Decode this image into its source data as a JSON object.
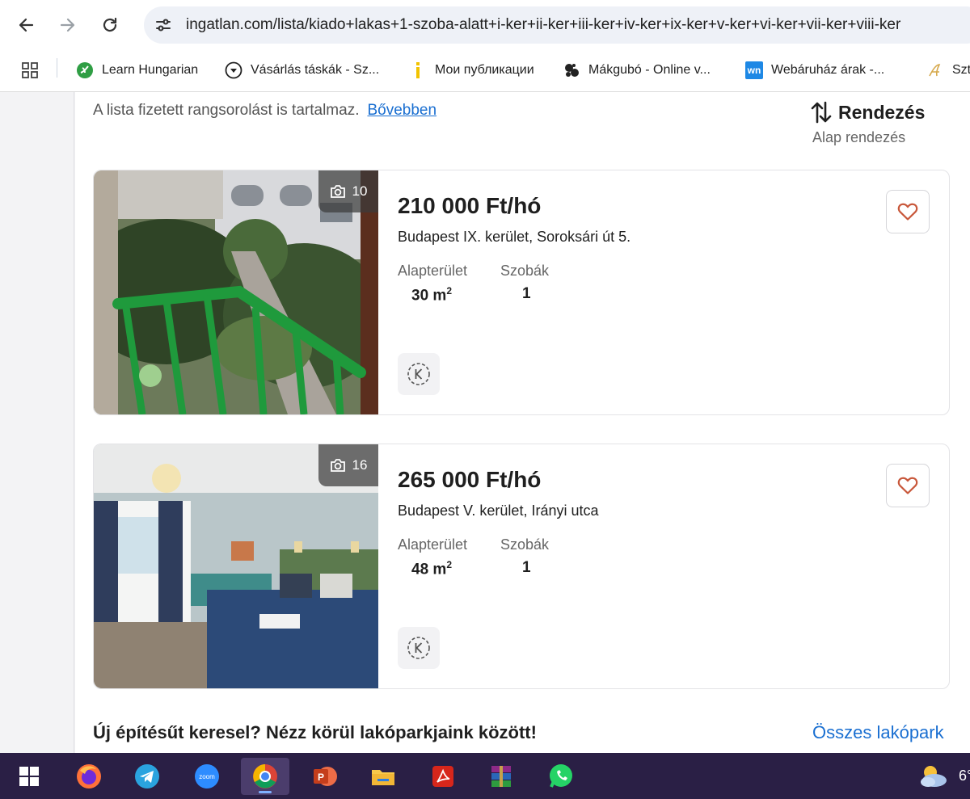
{
  "browser": {
    "url": "ingatlan.com/lista/kiado+lakas+1-szoba-alatt+i-ker+ii-ker+iii-ker+iv-ker+ix-ker+v-ker+vi-ker+vii-ker+viii-ker",
    "bookmarks": [
      {
        "label": "Learn Hungarian",
        "icon": "leaf-icon"
      },
      {
        "label": "Vásárlás táskák - Sz...",
        "icon": "chevron-circle-icon"
      },
      {
        "label": "Мои публикации",
        "icon": "yellow-bar-icon"
      },
      {
        "label": "Mákgubó - Online v...",
        "icon": "poppy-icon"
      },
      {
        "label": "Webáruház árak -...",
        "icon": "wn-icon",
        "icon_text": "wn"
      },
      {
        "label": "Szt",
        "icon": "script-a-icon"
      }
    ]
  },
  "listing_page": {
    "notice_text": "A lista fizetett rangsorolást is tartalmaz.",
    "notice_link": "Bővebben",
    "sort_label": "Rendezés",
    "sort_value": "Alap rendezés",
    "area_label": "Alapterület",
    "rooms_label": "Szobák",
    "area_unit": "m",
    "area_unit_sup": "2",
    "listings": [
      {
        "price": "210 000 Ft/hó",
        "address": "Budapest IX. kerület, Soroksári út 5.",
        "area": "30",
        "rooms": "1",
        "photo_count": "10"
      },
      {
        "price": "265 000 Ft/hó",
        "address": "Budapest V. kerület, Irányi utca",
        "area": "48",
        "rooms": "1",
        "photo_count": "16"
      }
    ],
    "promo_title": "Új építésűt keresel? Nézz körül lakóparkjaink között!",
    "promo_link": "Összes lakópark"
  },
  "taskbar": {
    "apps": [
      "windows-start",
      "firefox",
      "telegram",
      "zoom",
      "chrome",
      "powerpoint",
      "file-explorer",
      "acrobat",
      "winrar",
      "whatsapp"
    ],
    "zoom_text": "zoom",
    "powerpoint_letter": "P",
    "temperature": "6°"
  },
  "colors": {
    "link": "#1a6fd1",
    "heart": "#c8573a",
    "taskbar": "#2a1f45"
  }
}
